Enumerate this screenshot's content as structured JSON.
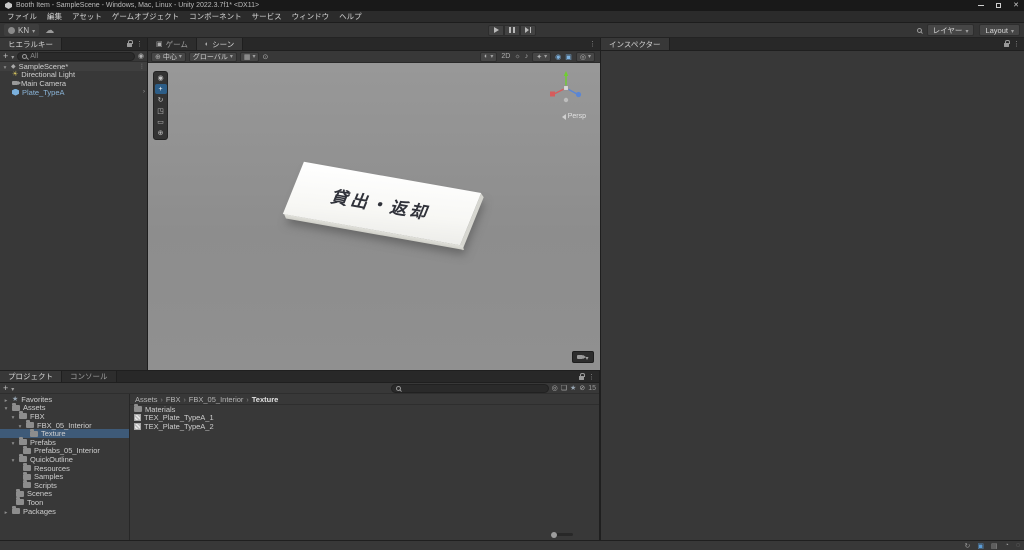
{
  "colors": {
    "selection_blue": "#2c5d87",
    "prefab_text_blue": "#8ab4d8",
    "axis_x_red": "#d65c5c",
    "axis_y_green": "#6fce30",
    "axis_z_blue": "#5a86d5",
    "panel_bg": "#383838",
    "titlebar_bg": "#191919"
  },
  "window": {
    "title": "Booth Item - SampleScene - Windows, Mac, Linux - Unity 2022.3.7f1* <DX11>"
  },
  "menubar": {
    "items": [
      "ファイル",
      "編集",
      "アセット",
      "ゲームオブジェクト",
      "コンポーネント",
      "サービス",
      "ウィンドウ",
      "ヘルプ"
    ]
  },
  "toolbar": {
    "account_label": "KN",
    "layers_label": "レイヤー",
    "layout_label": "Layout"
  },
  "hierarchy": {
    "tab_label": "ヒエラルキー",
    "search_text": "All",
    "scene_label": "SampleScene*",
    "items": [
      {
        "label": "Directional Light"
      },
      {
        "label": "Main Camera"
      },
      {
        "label": "Plate_TypeA"
      }
    ]
  },
  "scene": {
    "tab_game": "ゲーム",
    "tab_scene": "シーン",
    "pivot_label": "中心",
    "orientation_label": "グローバル",
    "label_2d": "2D",
    "persp_label": "Persp",
    "plate_text": "貸出・返却"
  },
  "inspector": {
    "tab_label": "インスペクター"
  },
  "project": {
    "tab_project": "プロジェクト",
    "tab_console": "コンソール",
    "hidden_count": "15",
    "favorites_label": "Favorites",
    "breadcrumb": [
      "Assets",
      "FBX",
      "FBX_05_Interior",
      "Texture"
    ],
    "tree": [
      {
        "label": "Assets"
      },
      {
        "label": "FBX"
      },
      {
        "label": "FBX_05_Interior"
      },
      {
        "label": "Texture"
      },
      {
        "label": "Prefabs"
      },
      {
        "label": "Prefabs_05_Interior"
      },
      {
        "label": "QuickOutline"
      },
      {
        "label": "Resources"
      },
      {
        "label": "Samples"
      },
      {
        "label": "Scripts"
      },
      {
        "label": "Scenes"
      },
      {
        "label": "Toon"
      },
      {
        "label": "Packages"
      }
    ],
    "files": [
      {
        "label": "Materials"
      },
      {
        "label": "TEX_Plate_TypeA_1"
      },
      {
        "label": "TEX_Plate_TypeA_2"
      }
    ]
  }
}
